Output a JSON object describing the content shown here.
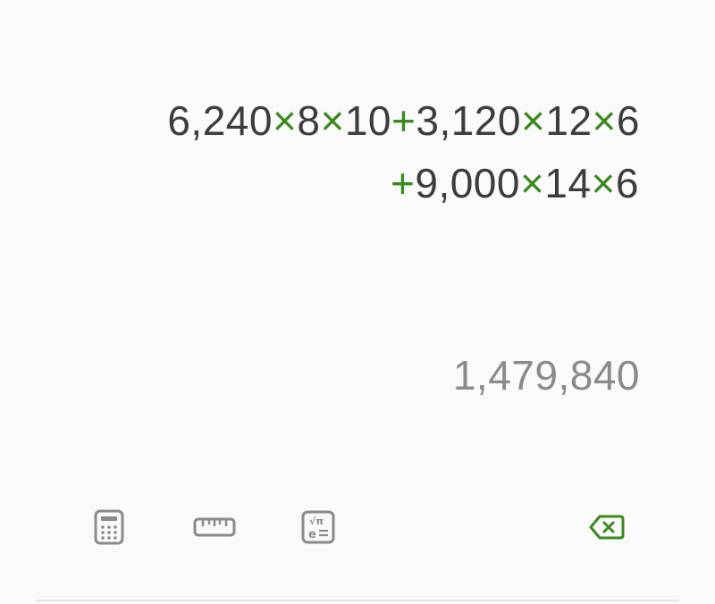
{
  "expression": {
    "line1": [
      {
        "text": "6,240",
        "kind": "num"
      },
      {
        "text": "×",
        "kind": "op"
      },
      {
        "text": "8",
        "kind": "num"
      },
      {
        "text": "×",
        "kind": "op"
      },
      {
        "text": "10",
        "kind": "num"
      },
      {
        "text": "+",
        "kind": "op"
      },
      {
        "text": "3,120",
        "kind": "num"
      },
      {
        "text": "×",
        "kind": "op"
      },
      {
        "text": "12",
        "kind": "num"
      },
      {
        "text": "×",
        "kind": "op"
      },
      {
        "text": "6",
        "kind": "num"
      }
    ],
    "line2": [
      {
        "text": "+",
        "kind": "op"
      },
      {
        "text": "9,000",
        "kind": "num"
      },
      {
        "text": "×",
        "kind": "op"
      },
      {
        "text": "14",
        "kind": "num"
      },
      {
        "text": "×",
        "kind": "op"
      },
      {
        "text": "6",
        "kind": "num"
      }
    ]
  },
  "result": "1,479,840",
  "toolbar": {
    "calculator_icon": "calculator-icon",
    "unit_converter_icon": "ruler-icon",
    "scientific_icon": "scientific-functions-icon",
    "backspace_icon": "backspace-icon"
  },
  "colors": {
    "operator": "#3a8a1e",
    "number": "#3c3c3c",
    "result": "#8a8a8a",
    "cursor": "#8fc8cf",
    "icon_gray": "#8a8a8a",
    "backspace_green": "#3a8a1e"
  }
}
